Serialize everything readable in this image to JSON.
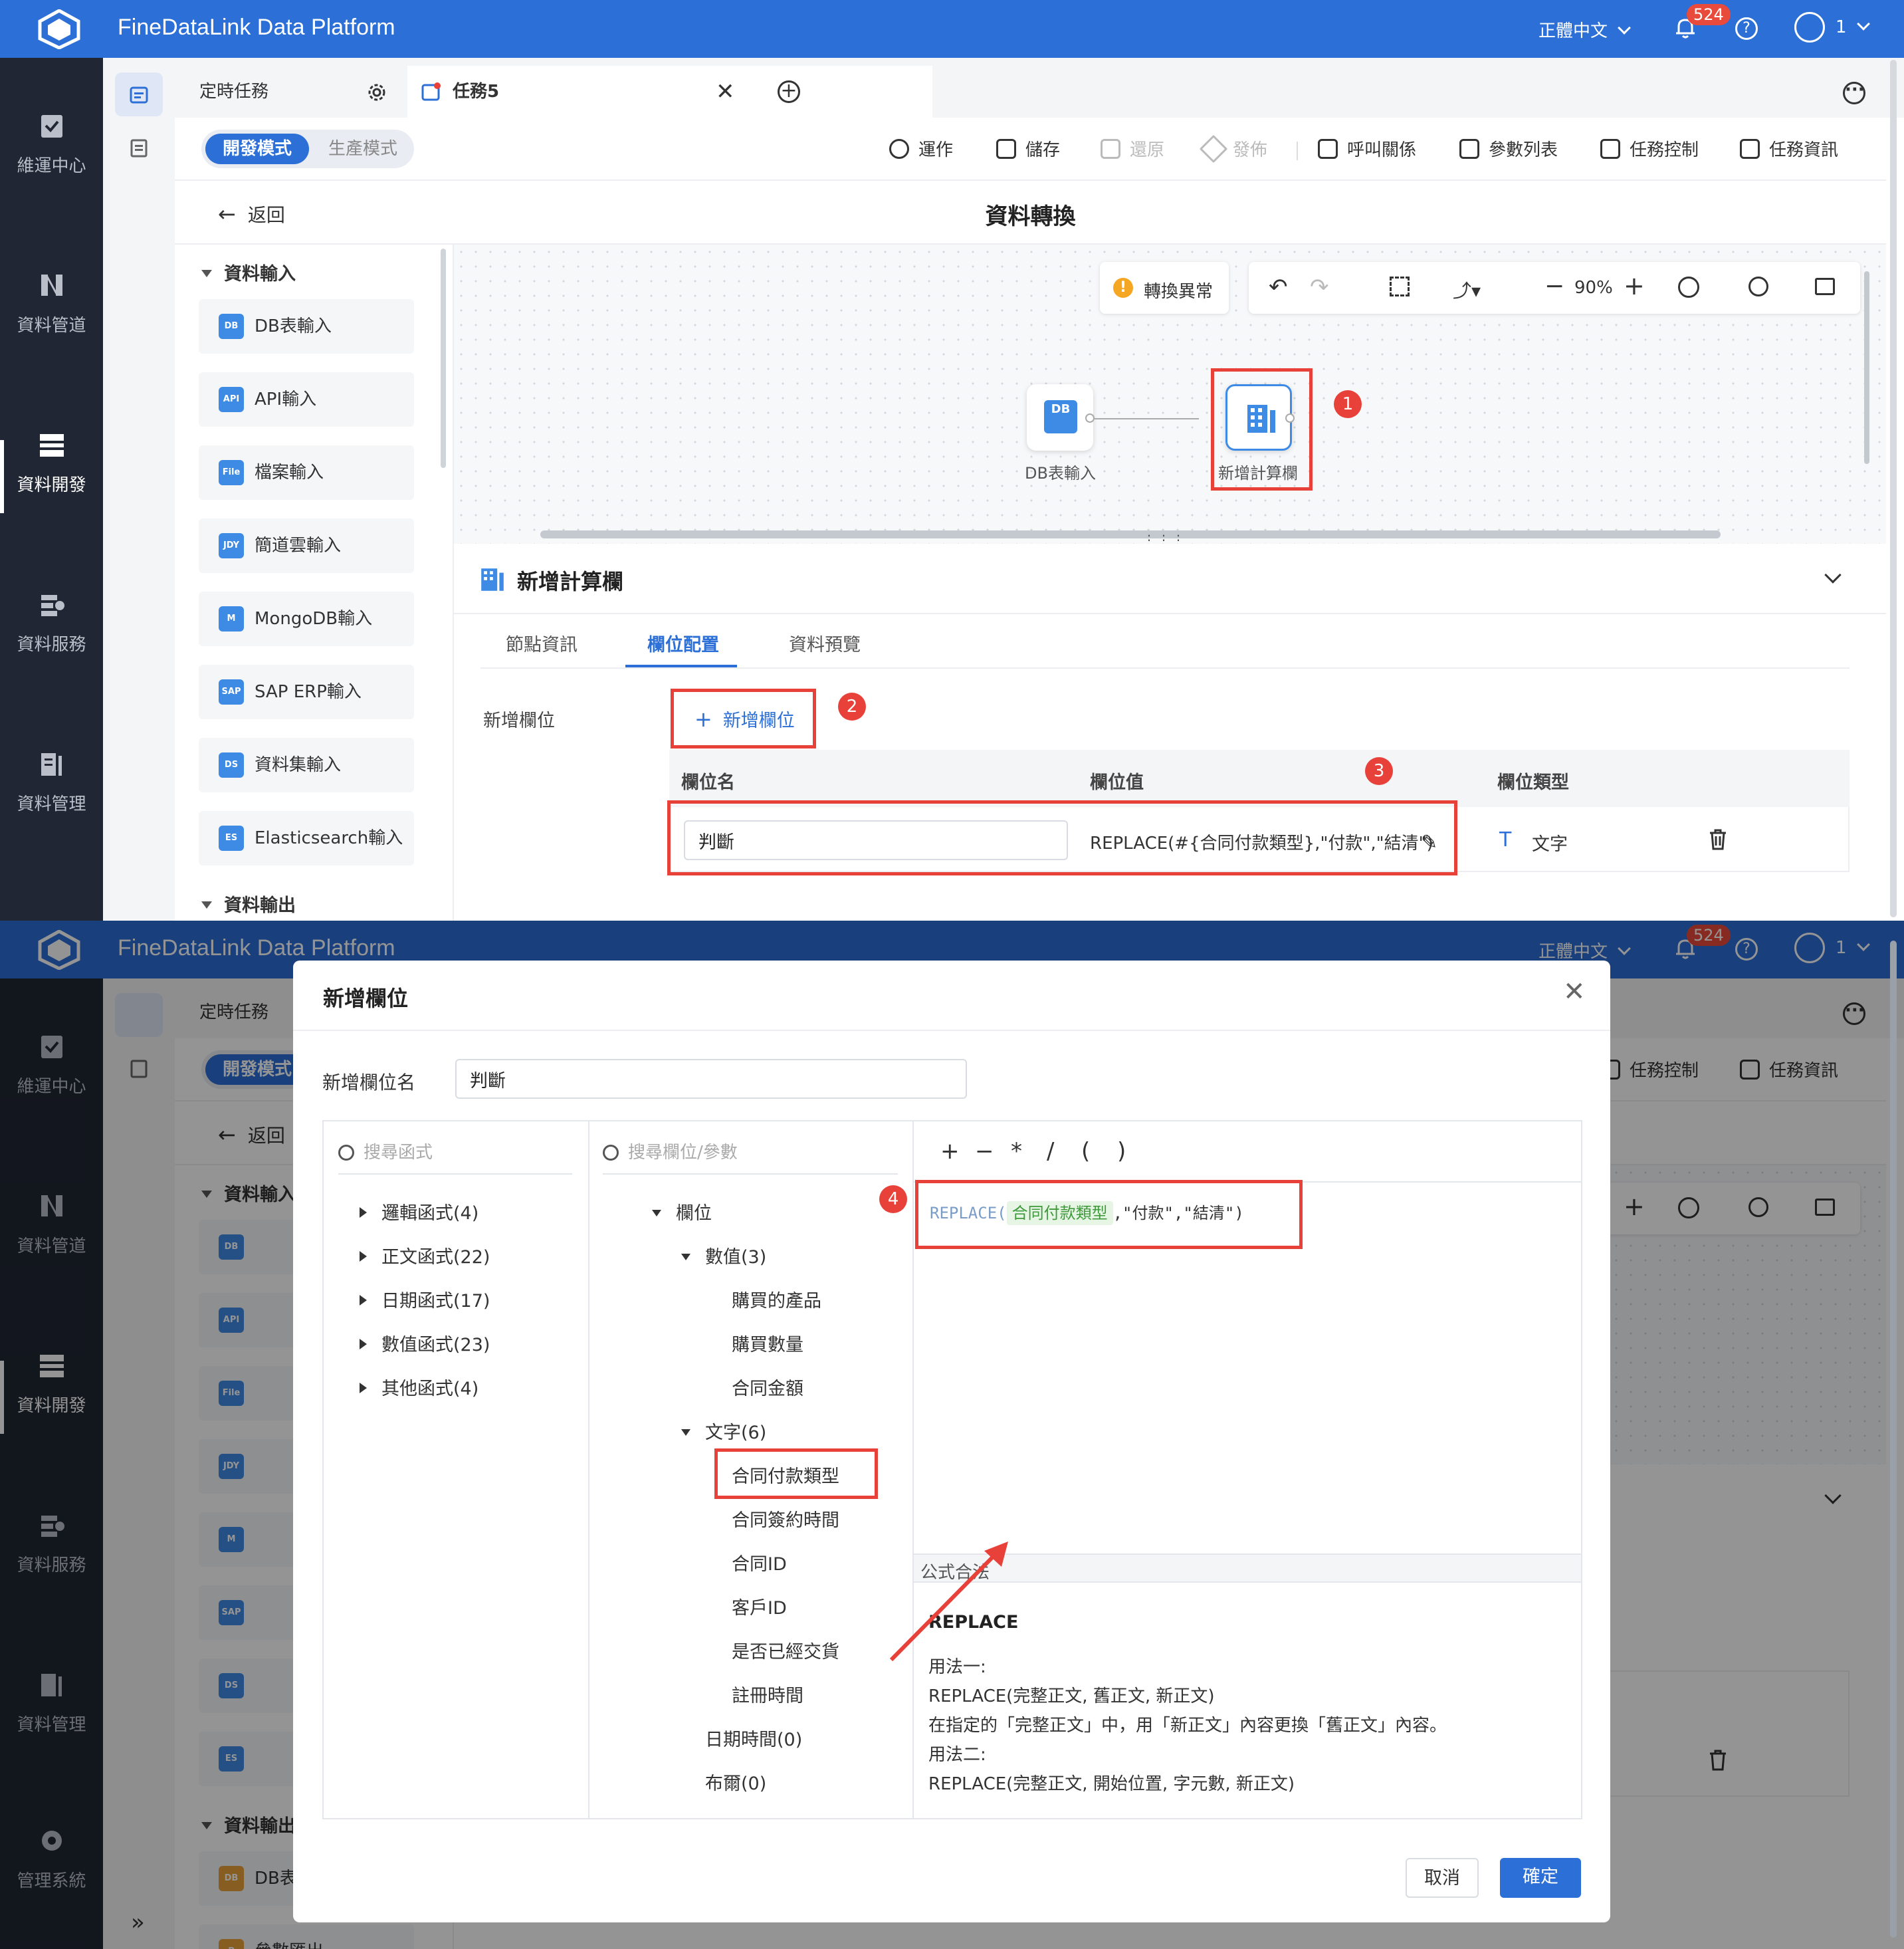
{
  "app": {
    "title": "FineDataLink Data Platform",
    "language": "正體中文",
    "notification_count": "524",
    "user": "1"
  },
  "sidebar": {
    "items": [
      {
        "label": "維運中心",
        "icon": "clipboard-check-icon"
      },
      {
        "label": "資料管道",
        "icon": "pipeline-icon"
      },
      {
        "label": "資料開發",
        "icon": "dev-icon"
      },
      {
        "label": "資料服務",
        "icon": "service-icon"
      },
      {
        "label": "資料管理",
        "icon": "manage-icon"
      },
      {
        "label": "管理系統",
        "icon": "gear-icon"
      }
    ]
  },
  "tabs": [
    {
      "label": "定時任務"
    },
    {
      "label": "任務5"
    }
  ],
  "toolbar": {
    "mode_dev": "開發模式",
    "mode_prod": "生產模式",
    "run": "運作",
    "save": "儲存",
    "restore": "還原",
    "publish": "發佈",
    "call_relation": "呼叫關係",
    "param_list": "參數列表",
    "task_control": "任務控制",
    "task_info": "任務資訊"
  },
  "page": {
    "back": "返回",
    "title": "資料轉換"
  },
  "left_panel": {
    "input_group": "資料輸入",
    "output_group": "資料輸出",
    "inputs": [
      {
        "label": "DB表輸入",
        "badge": "DB"
      },
      {
        "label": "API輸入",
        "badge": "API"
      },
      {
        "label": "檔案輸入",
        "badge": "File"
      },
      {
        "label": "簡道雲輸入",
        "badge": "JDY"
      },
      {
        "label": "MongoDB輸入",
        "badge": "M"
      },
      {
        "label": "SAP ERP輸入",
        "badge": "SAP"
      },
      {
        "label": "資料集輸入",
        "badge": "DS"
      },
      {
        "label": "Elasticsearch輸入",
        "badge": "ES"
      }
    ],
    "outputs": [
      {
        "label": "DB表",
        "badge": "DB"
      },
      {
        "label": "參數匯出",
        "badge": "P"
      }
    ]
  },
  "canvas": {
    "warning": "轉換異常",
    "zoom": "90%",
    "nodes": [
      {
        "label": "DB表輸入"
      },
      {
        "label": "新增計算欄"
      }
    ]
  },
  "bottom_panel": {
    "title": "新增計算欄",
    "tabs": [
      "節點資訊",
      "欄位配置",
      "資料預覽"
    ],
    "add_field_label": "新增欄位",
    "add_field_button": "新增欄位",
    "columns": [
      "欄位名",
      "欄位值",
      "欄位類型"
    ],
    "row": {
      "name": "判斷",
      "value": "REPLACE(#{合同付款類型},\"付款\",\"結清\")",
      "type": "文字"
    }
  },
  "dialog": {
    "title": "新增欄位",
    "field_name_label": "新增欄位名",
    "field_name_value": "判斷",
    "func_search_placeholder": "搜尋函式",
    "field_search_placeholder": "搜尋欄位/參數",
    "func_groups": [
      "邏輯函式(4)",
      "正文函式(22)",
      "日期函式(17)",
      "數值函式(23)",
      "其他函式(4)"
    ],
    "field_tree": {
      "root": "欄位",
      "numeric_group": "數值(3)",
      "numeric_fields": [
        "購買的產品",
        "購買數量",
        "合同金額"
      ],
      "text_group": "文字(6)",
      "text_fields": [
        "合同付款類型",
        "合同簽約時間",
        "合同ID",
        "客戶ID",
        "是否已經交貨",
        "註冊時間"
      ],
      "date_group": "日期時間(0)",
      "bool_group": "布爾(0)"
    },
    "operators": [
      "+",
      "−",
      "*",
      "/",
      "(",
      ")"
    ],
    "formula": {
      "func": "REPLACE",
      "open": "(",
      "field": "合同付款類型",
      "args": ",\"付款\",\"結清\"",
      "close": ")"
    },
    "status": "公式合法",
    "help": {
      "name": "REPLACE",
      "usage1_title": "用法一:",
      "usage1_syntax": "REPLACE(完整正文, 舊正文, 新正文)",
      "usage1_desc": "在指定的「完整正文」中，用「新正文」內容更換「舊正文」內容。",
      "usage2_title": "用法二:",
      "usage2_syntax": "REPLACE(完整正文, 開始位置, 字元數, 新正文)"
    },
    "cancel": "取消",
    "confirm": "確定"
  },
  "annotations": [
    "1",
    "2",
    "3",
    "4"
  ],
  "colors": {
    "brand_blue": "#2c6fd6",
    "annotation_red": "#e8413a",
    "sidebar_dark": "#202633",
    "field_highlight_green": "#e6f5e4"
  }
}
